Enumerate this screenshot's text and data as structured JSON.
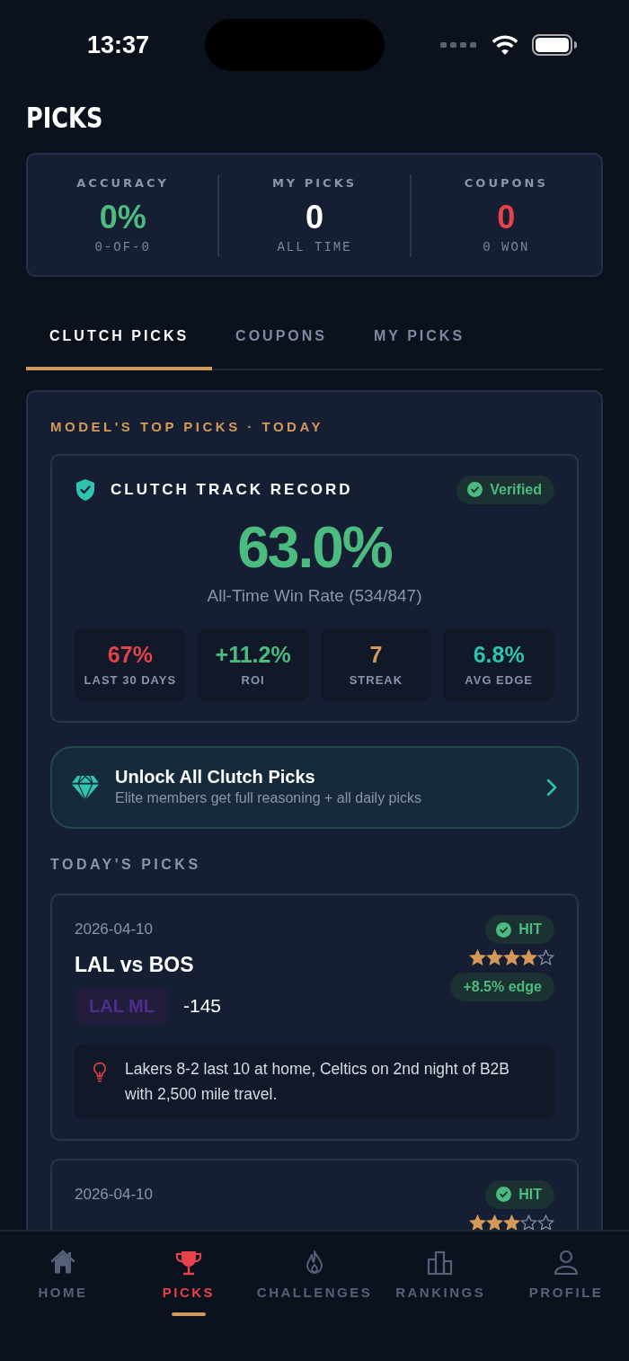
{
  "status_bar": {
    "time": "13:37"
  },
  "title": "PICKS",
  "summary": [
    {
      "label": "ACCURACY",
      "value": "0%",
      "sub": "0-OF-0",
      "color": "#4cbb7f"
    },
    {
      "label": "MY PICKS",
      "value": "0",
      "sub": "ALL TIME",
      "color": "#ffffff"
    },
    {
      "label": "COUPONS",
      "value": "0",
      "sub": "0 WON",
      "color": "#e5434b"
    }
  ],
  "tabs": [
    {
      "label": "CLUTCH PICKS",
      "selected": true
    },
    {
      "label": "COUPONS",
      "selected": false
    },
    {
      "label": "MY PICKS",
      "selected": false
    }
  ],
  "section_title": "MODEL'S TOP PICKS · TODAY",
  "track_record": {
    "title": "CLUTCH TRACK RECORD",
    "badge": "Verified",
    "rate": "63.0%",
    "caption": "All-Time Win Rate (534/847)",
    "metrics": [
      {
        "value": "67%",
        "label": "LAST 30 DAYS",
        "color": "#e5434b"
      },
      {
        "value": "+11.2%",
        "label": "ROI",
        "color": "#4cbb7f"
      },
      {
        "value": "7",
        "label": "STREAK",
        "color": "#d49a5a"
      },
      {
        "value": "6.8%",
        "label": "AVG EDGE",
        "color": "#2ec4b0"
      }
    ]
  },
  "unlock": {
    "title": "Unlock All Clutch Picks",
    "subtitle": "Elite members get full reasoning + all daily picks"
  },
  "todays_picks": {
    "title": "TODAY'S PICKS",
    "picks": [
      {
        "date": "2026-04-10",
        "result": "HIT",
        "matchup": "LAL vs BOS",
        "stars": 4,
        "edge": "+8.5% edge",
        "pick": "LAL ML",
        "odds": "-145",
        "reason": "Lakers 8-2 last 10 at home, Celtics on 2nd night of B2B with 2,500 mile travel."
      },
      {
        "date": "2026-04-10",
        "result": "HIT",
        "stars": 3
      }
    ]
  },
  "bottom_nav": [
    {
      "label": "HOME",
      "kind": "home",
      "selected": false
    },
    {
      "label": "PICKS",
      "kind": "trophy",
      "selected": true
    },
    {
      "label": "CHALLENGES",
      "kind": "flame",
      "selected": false
    },
    {
      "label": "RANKINGS",
      "kind": "bars",
      "selected": false
    },
    {
      "label": "PROFILE",
      "kind": "person",
      "selected": false
    }
  ]
}
